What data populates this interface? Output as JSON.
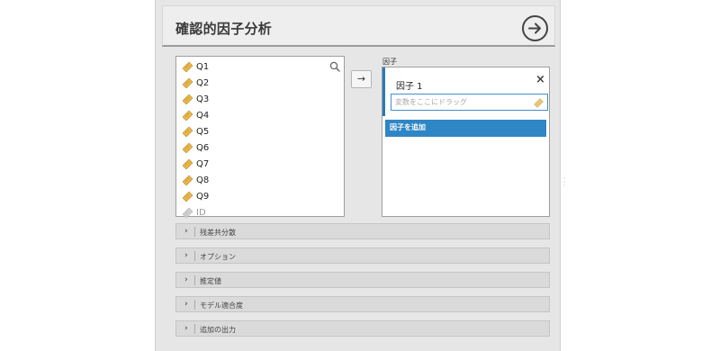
{
  "analysis": {
    "title": "確認的因子分析"
  },
  "variables": {
    "search_icon": "search-icon",
    "items": [
      {
        "name": "Q1",
        "icon": "ruler-icon",
        "type": "continuous"
      },
      {
        "name": "Q2",
        "icon": "ruler-icon",
        "type": "continuous"
      },
      {
        "name": "Q3",
        "icon": "ruler-icon",
        "type": "continuous"
      },
      {
        "name": "Q4",
        "icon": "ruler-icon",
        "type": "continuous"
      },
      {
        "name": "Q5",
        "icon": "ruler-icon",
        "type": "continuous"
      },
      {
        "name": "Q6",
        "icon": "ruler-icon",
        "type": "continuous"
      },
      {
        "name": "Q7",
        "icon": "ruler-icon",
        "type": "continuous"
      },
      {
        "name": "Q8",
        "icon": "ruler-icon",
        "type": "continuous"
      },
      {
        "name": "Q9",
        "icon": "ruler-icon",
        "type": "continuous"
      },
      {
        "name": "ID",
        "icon": "ruler-icon-gray",
        "type": "id"
      }
    ]
  },
  "move_button": {
    "label": "→"
  },
  "factors": {
    "label": "因子",
    "items": [
      {
        "name": "因子 1",
        "drop_placeholder": "変数をここにドラッグ",
        "close_label": "×"
      }
    ],
    "add_label": "因子を追加"
  },
  "sections": [
    {
      "label": "残差共分散",
      "chevron": "›"
    },
    {
      "label": "オプション",
      "chevron": "›"
    },
    {
      "label": "推定値",
      "chevron": "›"
    },
    {
      "label": "モデル適合度",
      "chevron": "›"
    },
    {
      "label": "追加の出力",
      "chevron": "›"
    }
  ],
  "colors": {
    "accent": "#2f86c4",
    "ruler": "#e8b54a",
    "panel_bg": "#e6e6e6"
  }
}
